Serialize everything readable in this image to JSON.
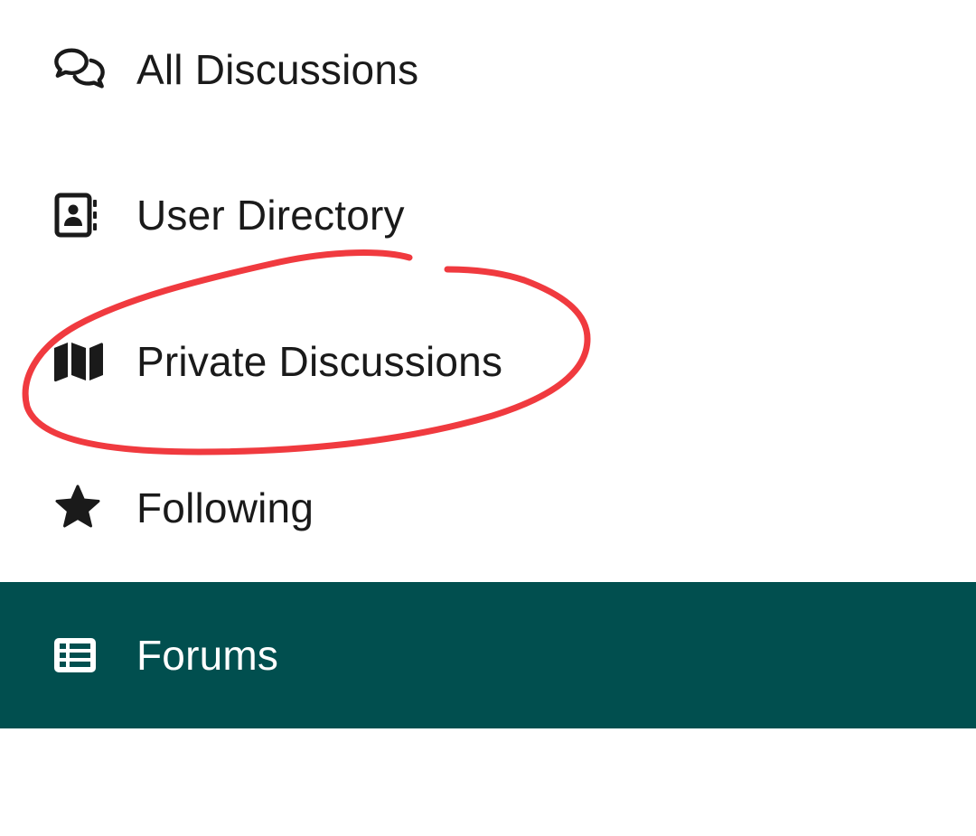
{
  "menu": {
    "items": [
      {
        "label": "All Discussions",
        "icon": "chat-bubbles-icon",
        "active": false
      },
      {
        "label": "User Directory",
        "icon": "address-book-icon",
        "active": false
      },
      {
        "label": "Private Discussions",
        "icon": "map-icon",
        "active": false
      },
      {
        "label": "Following",
        "icon": "star-icon",
        "active": false
      },
      {
        "label": "Forums",
        "icon": "list-icon",
        "active": true
      }
    ]
  },
  "colors": {
    "active_background": "#014f4f",
    "text": "#1a1a1a",
    "active_text": "#ffffff",
    "annotation": "#f03a3f"
  }
}
